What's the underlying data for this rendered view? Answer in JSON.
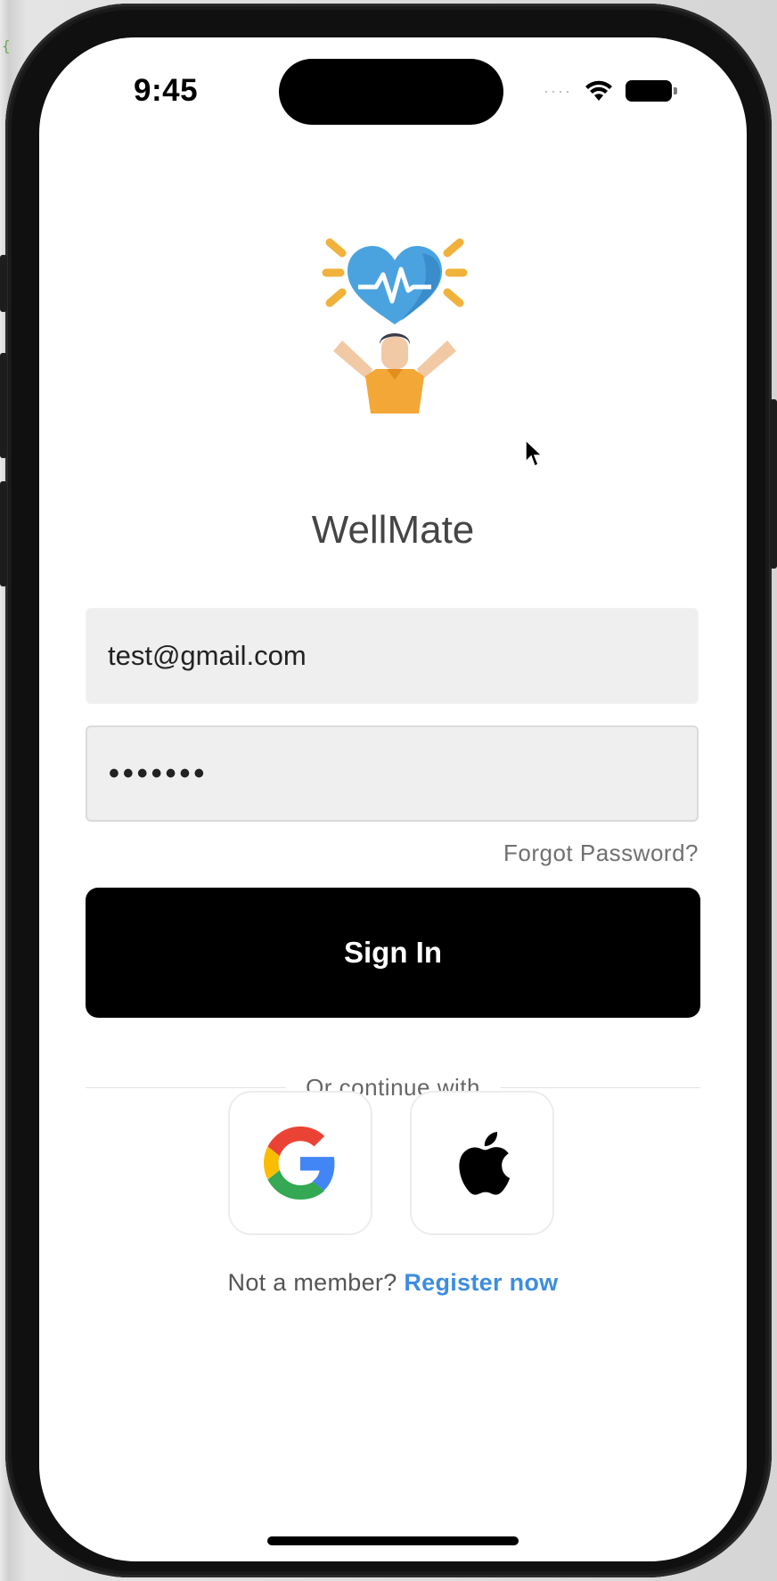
{
  "status_bar": {
    "time": "9:45",
    "signal": "wifi-icon",
    "battery": "battery-icon"
  },
  "app": {
    "title": "WellMate",
    "logo_icon": "heart-person-icon"
  },
  "form": {
    "email_value": "test@gmail.com",
    "password_value": "•••••••",
    "forgot_label": "Forgot Password?",
    "signin_label": "Sign In"
  },
  "social": {
    "divider_label": "Or continue with",
    "google_icon": "google-icon",
    "apple_icon": "apple-icon"
  },
  "register": {
    "prompt": "Not a member?",
    "link_label": "Register now"
  },
  "colors": {
    "primary_button": "#000000",
    "link": "#3d8de0",
    "heart": "#4aa3df",
    "sparkle": "#f0b23a",
    "shirt": "#f3a736"
  }
}
